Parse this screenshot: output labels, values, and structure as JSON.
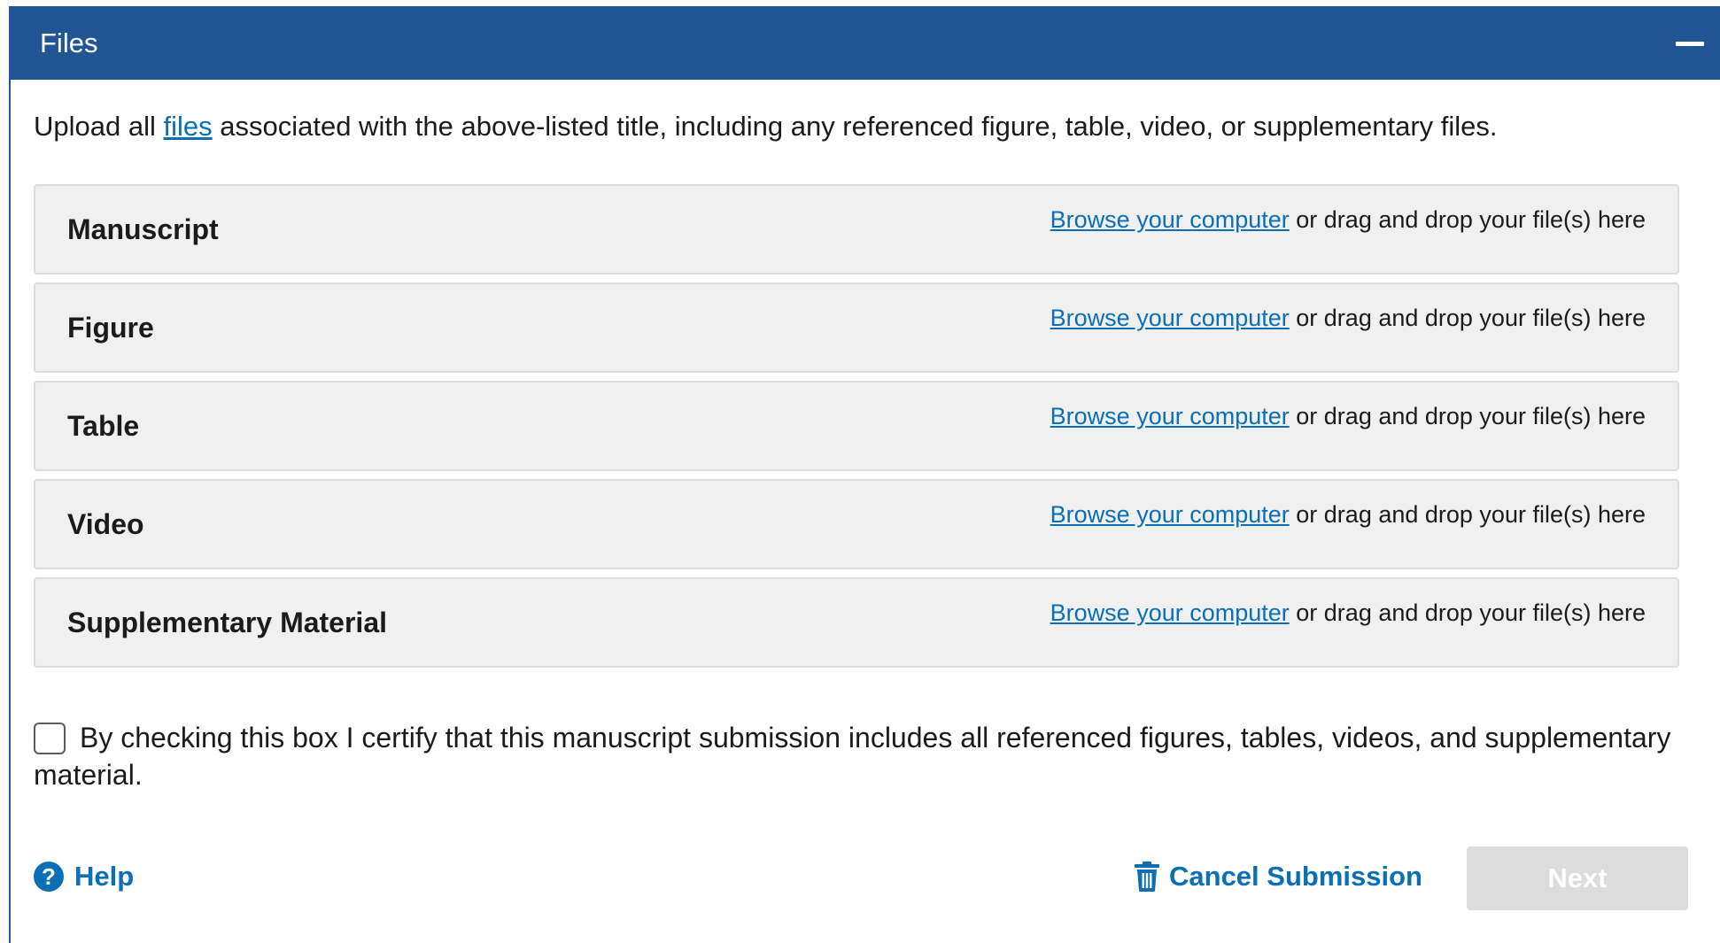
{
  "panel": {
    "title": "Files"
  },
  "intro": {
    "before": "Upload all ",
    "link": "files",
    "after": " associated with the above-listed title, including any referenced figure, table, video, or supplementary files."
  },
  "upload_rows": [
    {
      "label": "Manuscript",
      "browse_link": "Browse your computer",
      "drop_text": " or drag and drop your file(s) here"
    },
    {
      "label": "Figure",
      "browse_link": "Browse your computer",
      "drop_text": " or drag and drop your file(s) here"
    },
    {
      "label": "Table",
      "browse_link": "Browse your computer",
      "drop_text": " or drag and drop your file(s) here"
    },
    {
      "label": "Video",
      "browse_link": "Browse your computer",
      "drop_text": " or drag and drop your file(s) here"
    },
    {
      "label": "Supplementary Material",
      "browse_link": "Browse your computer",
      "drop_text": " or drag and drop your file(s) here"
    }
  ],
  "certify": {
    "checked": false,
    "text": "By checking this box I certify that this manuscript submission includes all referenced figures, tables, videos, and supplementary material."
  },
  "footer": {
    "help_label": "Help",
    "help_icon": "question-circle-icon",
    "cancel_label": "Cancel Submission",
    "cancel_icon": "trash-icon",
    "next_label": "Next",
    "next_disabled": true
  },
  "colors": {
    "header_bg": "#215594",
    "link": "#0a6fb5",
    "row_bg": "#f0f0f0",
    "disabled_button": "#dcdcdc"
  }
}
